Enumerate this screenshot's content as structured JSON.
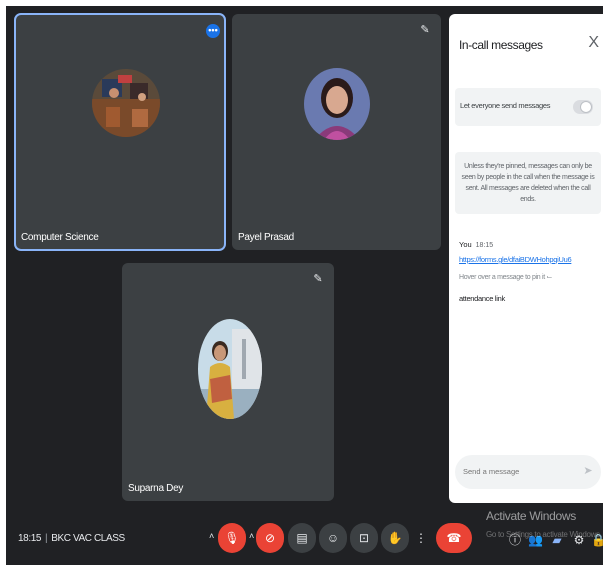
{
  "participants": [
    {
      "name": "Computer Science"
    },
    {
      "name": "Payel Prasad"
    },
    {
      "name": "Suparna Dey"
    }
  ],
  "chat": {
    "title": "In-call messages",
    "close_label": "X",
    "toggle_label": "Let everyone send messages",
    "info_text": "Unless they're pinned, messages can only be seen by people in the call when the message is sent. All messages are deleted when the call ends.",
    "message": {
      "sender": "You",
      "time": "18:15",
      "link": "https://forms.gle/dfaiBDWHohpqiUu6",
      "hint": "Hover over a message to pin it ⌙",
      "text": "attendance link"
    },
    "input_placeholder": "Send a message"
  },
  "bottom_bar": {
    "time": "18:15",
    "separator": "|",
    "meeting_name": "BKC VAC CLASS"
  },
  "watermark": {
    "line1": "Activate Windows",
    "line2": "Go to Settings to activate Windows."
  },
  "colors": {
    "background": "#202124",
    "tile": "#3c4043",
    "active_outline": "#8ab4f8",
    "end_call": "#ea4335",
    "accent": "#1a73e8"
  }
}
